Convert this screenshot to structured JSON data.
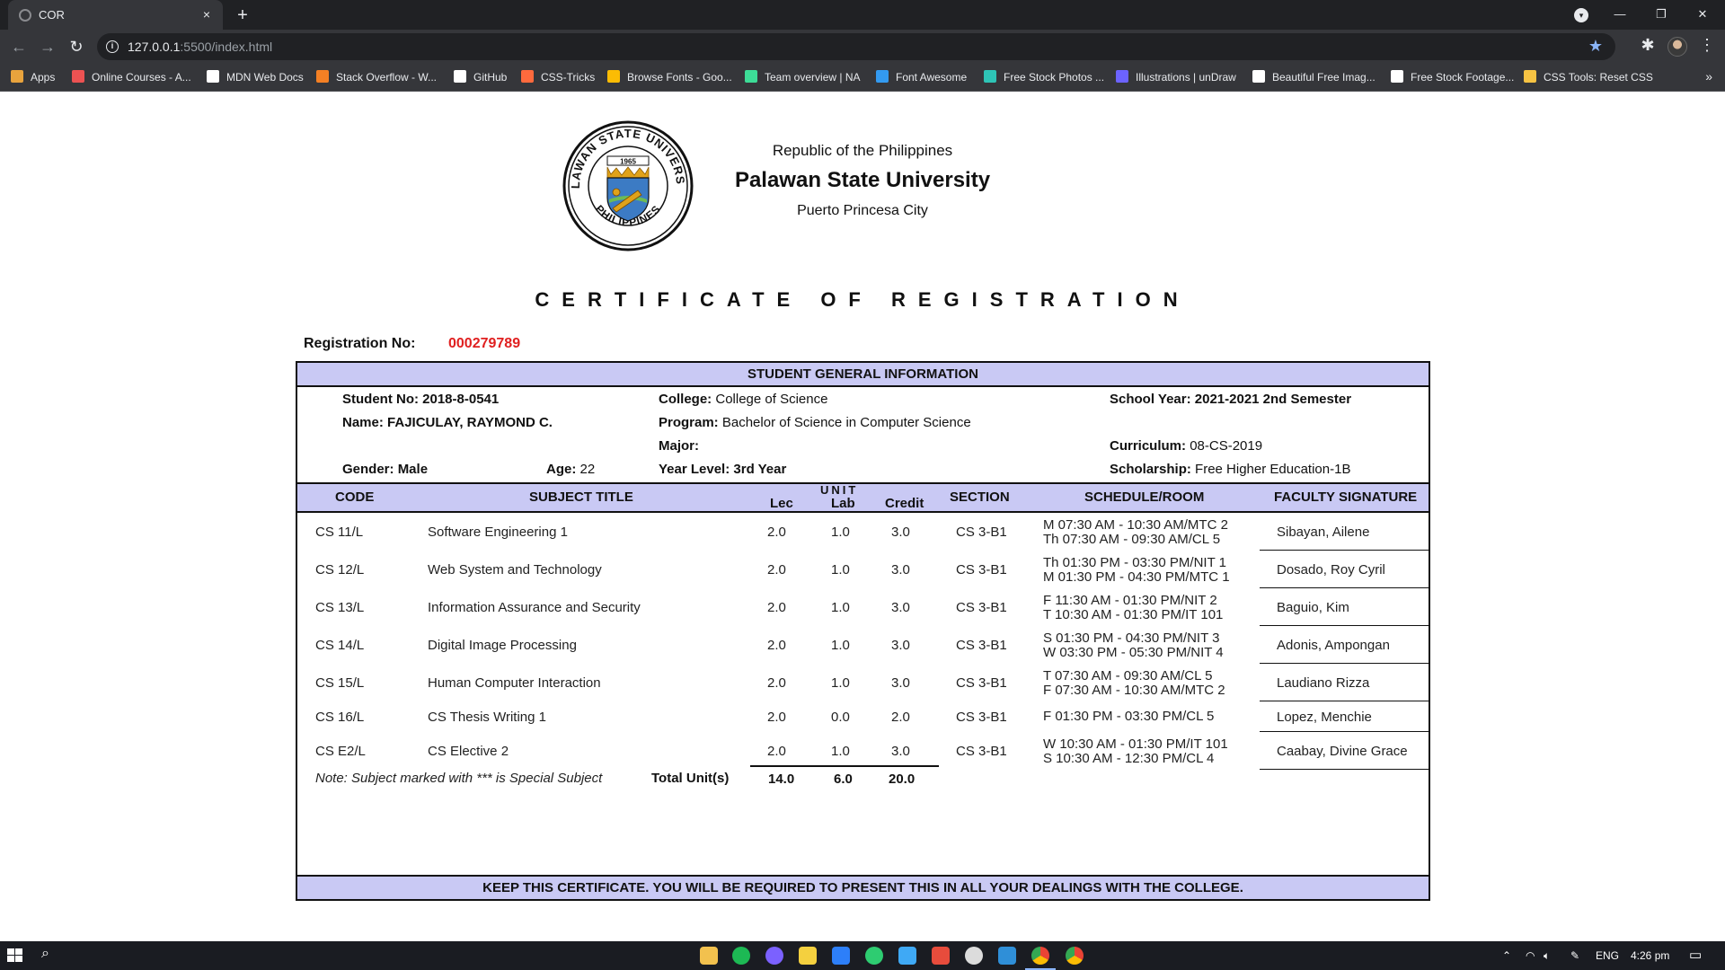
{
  "browser": {
    "tab_title": "COR",
    "tab_close": "×",
    "new_tab": "+",
    "url_host": "127.0.0.1",
    "url_rest": ":5500/index.html",
    "bookmarks": [
      {
        "label": "Apps",
        "color": "#e8a33d"
      },
      {
        "label": "Online Courses - A...",
        "color": "#ec5252"
      },
      {
        "label": "MDN Web Docs",
        "color": "#ffffff"
      },
      {
        "label": "Stack Overflow - W...",
        "color": "#f48024"
      },
      {
        "label": "GitHub",
        "color": "#ffffff"
      },
      {
        "label": "CSS-Tricks",
        "color": "#ff6a3d"
      },
      {
        "label": "Browse Fonts - Goo...",
        "color": "#fbbc04"
      },
      {
        "label": "Team overview | NA",
        "color": "#3ddc97"
      },
      {
        "label": "Font Awesome",
        "color": "#339af0"
      },
      {
        "label": "Free Stock Photos ...",
        "color": "#2ec4b6"
      },
      {
        "label": "Illustrations | unDraw",
        "color": "#6c63ff"
      },
      {
        "label": "Beautiful Free Imag...",
        "color": "#ffffff"
      },
      {
        "label": "Free Stock Footage...",
        "color": "#ffffff"
      },
      {
        "label": "CSS Tools: Reset CSS",
        "color": "#f6c343"
      }
    ],
    "bookmarks_more": "»"
  },
  "header": {
    "line1": "Republic of the Philippines",
    "line2": "Palawan State University",
    "line3": "Puerto Princesa City",
    "seal_text_top": "PALAWAN STATE UNIVERSITY",
    "seal_text_bottom": "PHILIPPINES",
    "seal_year": "1965"
  },
  "certificate": {
    "title": "CERTIFICATE OF REGISTRATION",
    "reg_label": "Registration No:",
    "reg_no": "000279789",
    "band_top": "STUDENT GENERAL INFORMATION",
    "band_bottom": "KEEP THIS CERTIFICATE. YOU WILL BE REQUIRED TO PRESENT THIS IN ALL YOUR DEALINGS WITH THE COLLEGE."
  },
  "student": {
    "student_no_label": "Student No:",
    "student_no": "2018-8-0541",
    "name_label": "Name:",
    "name": "FAJICULAY, RAYMOND C.",
    "gender_label": "Gender:",
    "gender": "Male",
    "age_label": "Age:",
    "age": "22",
    "college_label": "College:",
    "college": "College of Science",
    "program_label": "Program:",
    "program": "Bachelor of Science in Computer Science",
    "major_label": "Major:",
    "major": "",
    "year_level_label": "Year Level:",
    "year_level": "3rd Year",
    "school_year_label": "School Year:",
    "school_year": "2021-2021 2nd Semester",
    "curriculum_label": "Curriculum:",
    "curriculum": "08-CS-2019",
    "scholarship_label": "Scholarship:",
    "scholarship": "Free Higher Education-1B"
  },
  "table": {
    "headers": {
      "code": "CODE",
      "title": "SUBJECT TITLE",
      "unit": "UNIT",
      "lec": "Lec",
      "lab": "Lab",
      "credit": "Credit",
      "section": "SECTION",
      "schedule": "SCHEDULE/ROOM",
      "faculty": "FACULTY SIGNATURE"
    },
    "rows": [
      {
        "code": "CS 11/L",
        "title": "Software Engineering 1",
        "lec": "2.0",
        "lab": "1.0",
        "credit": "3.0",
        "section": "CS 3-B1",
        "sched1": "M 07:30 AM - 10:30 AM/MTC 2",
        "sched2": "Th 07:30 AM - 09:30 AM/CL 5",
        "faculty": "Sibayan, Ailene"
      },
      {
        "code": "CS 12/L",
        "title": "Web System and Technology",
        "lec": "2.0",
        "lab": "1.0",
        "credit": "3.0",
        "section": "CS 3-B1",
        "sched1": "Th 01:30 PM - 03:30 PM/NIT 1",
        "sched2": "M 01:30 PM - 04:30 PM/MTC 1",
        "faculty": "Dosado, Roy Cyril"
      },
      {
        "code": "CS 13/L",
        "title": "Information Assurance and Security",
        "lec": "2.0",
        "lab": "1.0",
        "credit": "3.0",
        "section": "CS 3-B1",
        "sched1": "F 11:30 AM - 01:30 PM/NIT 2",
        "sched2": "T 10:30 AM - 01:30 PM/IT 101",
        "faculty": "Baguio, Kim"
      },
      {
        "code": "CS 14/L",
        "title": "Digital Image Processing",
        "lec": "2.0",
        "lab": "1.0",
        "credit": "3.0",
        "section": "CS 3-B1",
        "sched1": "S 01:30 PM - 04:30 PM/NIT 3",
        "sched2": "W 03:30 PM - 05:30 PM/NIT 4",
        "faculty": "Adonis, Ampongan"
      },
      {
        "code": "CS 15/L",
        "title": "Human Computer Interaction",
        "lec": "2.0",
        "lab": "1.0",
        "credit": "3.0",
        "section": "CS 3-B1",
        "sched1": "T 07:30 AM - 09:30 AM/CL 5",
        "sched2": "F 07:30 AM - 10:30 AM/MTC 2",
        "faculty": "Laudiano Rizza"
      },
      {
        "code": "CS 16/L",
        "title": "CS Thesis Writing 1",
        "lec": "2.0",
        "lab": "0.0",
        "credit": "2.0",
        "section": "CS 3-B1",
        "sched1": "F 01:30 PM - 03:30 PM/CL 5",
        "sched2": "",
        "faculty": "Lopez, Menchie"
      },
      {
        "code": "CS E2/L",
        "title": "CS Elective 2",
        "lec": "2.0",
        "lab": "1.0",
        "credit": "3.0",
        "section": "CS 3-B1",
        "sched1": "W 10:30 AM - 01:30 PM/IT 101",
        "sched2": "S 10:30 AM - 12:30 PM/CL 4",
        "faculty": "Caabay, Divine Grace"
      }
    ],
    "note": "Note: Subject marked with *** is Special Subject",
    "total_label": "Total Unit(s)",
    "total_lec": "14.0",
    "total_lab": "6.0",
    "total_credit": "20.0"
  },
  "taskbar": {
    "lang": "ENG",
    "time": "4:26 pm"
  }
}
